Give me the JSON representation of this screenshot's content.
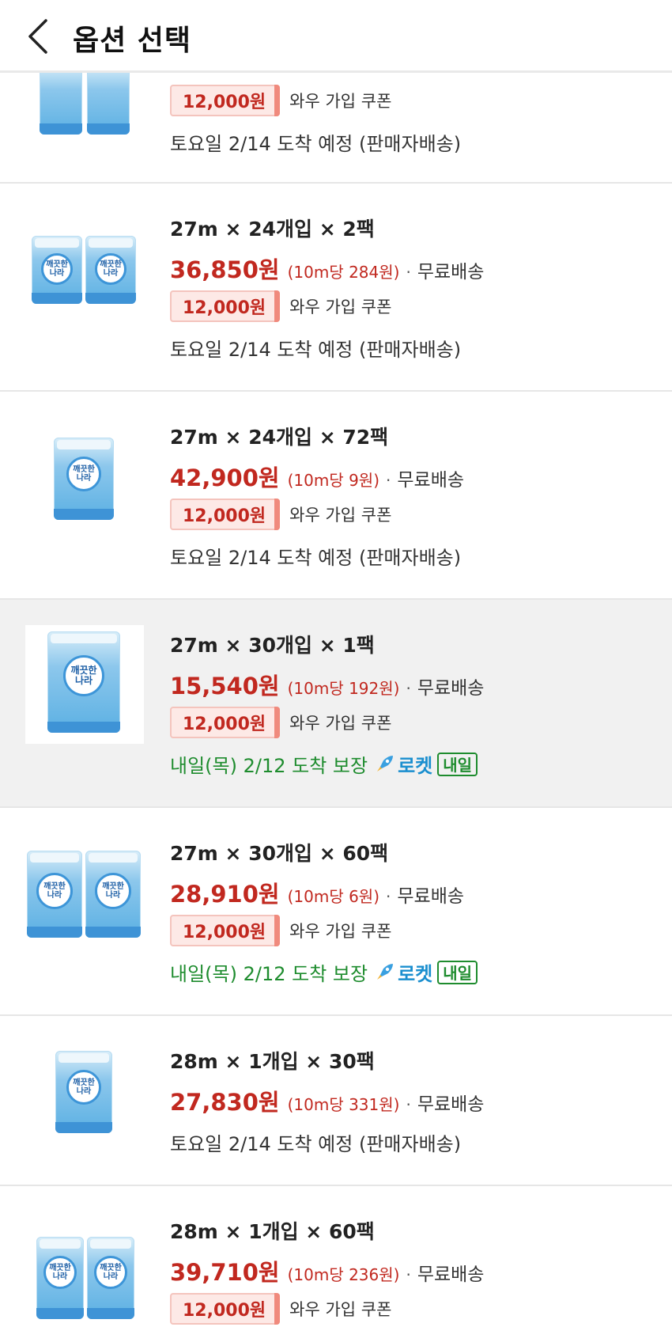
{
  "header": {
    "title": "옵션 선택"
  },
  "options": [
    {
      "name": "",
      "price": "",
      "unit_price": "",
      "shipping": "",
      "coupon": "12,000원",
      "coupon_label": "와우 가입 쿠폰",
      "delivery": "토요일 2/14 도착 예정 (판매자배송)"
    },
    {
      "name": "27m × 24개입 × 2팩",
      "price": "36,850원",
      "unit_price": "(10m당 284원)",
      "shipping": "무료배송",
      "coupon": "12,000원",
      "coupon_label": "와우 가입 쿠폰",
      "delivery": "토요일 2/14 도착 예정 (판매자배송)"
    },
    {
      "name": "27m × 24개입 × 72팩",
      "price": "42,900원",
      "unit_price": "(10m당 9원)",
      "shipping": "무료배송",
      "coupon": "12,000원",
      "coupon_label": "와우 가입 쿠폰",
      "delivery": "토요일 2/14 도착 예정 (판매자배송)"
    },
    {
      "name": "27m × 30개입 × 1팩",
      "price": "15,540원",
      "unit_price": "(10m당 192원)",
      "shipping": "무료배송",
      "coupon": "12,000원",
      "coupon_label": "와우 가입 쿠폰",
      "delivery": "내일(목) 2/12 도착 보장",
      "rocket": "로켓",
      "rocket_badge": "내일"
    },
    {
      "name": "27m × 30개입 × 60팩",
      "price": "28,910원",
      "unit_price": "(10m당 6원)",
      "shipping": "무료배송",
      "coupon": "12,000원",
      "coupon_label": "와우 가입 쿠폰",
      "delivery": "내일(목) 2/12 도착 보장",
      "rocket": "로켓",
      "rocket_badge": "내일"
    },
    {
      "name": "28m × 1개입 × 30팩",
      "price": "27,830원",
      "unit_price": "(10m당 331원)",
      "shipping": "무료배송",
      "delivery": "토요일 2/14 도착 예정 (판매자배송)"
    },
    {
      "name": "28m × 1개입 × 60팩",
      "price": "39,710원",
      "unit_price": "(10m당 236원)",
      "shipping": "무료배송",
      "coupon": "12,000원",
      "coupon_label": "와우 가입 쿠폰"
    }
  ],
  "product_logo_text": "깨끗한\n나라",
  "icons": {
    "back": "chevron-left-icon",
    "rocket": "rocket-icon"
  },
  "colors": {
    "price": "#c1281f",
    "rocket_green": "#1e8c2e",
    "rocket_blue": "#1b8fcf",
    "selected_bg": "#f1f1f1"
  }
}
